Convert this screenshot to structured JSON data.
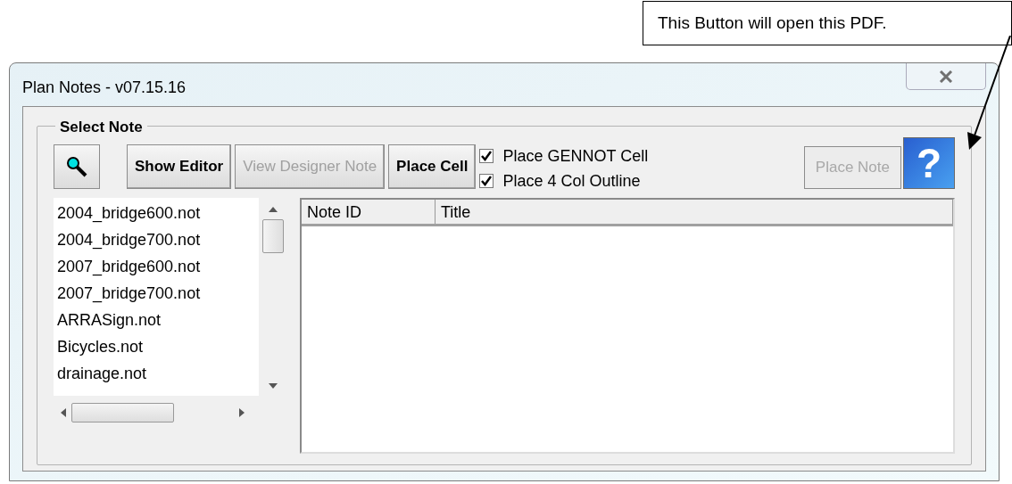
{
  "callout": {
    "text": "This Button will open this PDF."
  },
  "window": {
    "title": "Plan Notes - v07.15.16"
  },
  "group": {
    "label": "Select Note"
  },
  "toolbar": [
    {
      "kind": "search"
    },
    {
      "kind": "button",
      "label": "Show Editor",
      "disabled": false
    },
    {
      "kind": "button",
      "label": "View Designer Note",
      "disabled": true
    },
    {
      "kind": "button",
      "label": "Place Cell",
      "disabled": false
    }
  ],
  "options": [
    {
      "label": "Place GENNOT Cell",
      "checked": true
    },
    {
      "label": "Place 4 Col Outline",
      "checked": true
    }
  ],
  "place_note": {
    "label": "Place Note",
    "disabled": true
  },
  "help": {
    "label": "?"
  },
  "files": [
    "2004_bridge600.not",
    "2004_bridge700.not",
    "2007_bridge600.not",
    "2007_bridge700.not",
    "ARRASign.not",
    "Bicycles.not",
    "drainage.not"
  ],
  "table": {
    "columns": [
      "Note ID",
      "Title"
    ]
  }
}
